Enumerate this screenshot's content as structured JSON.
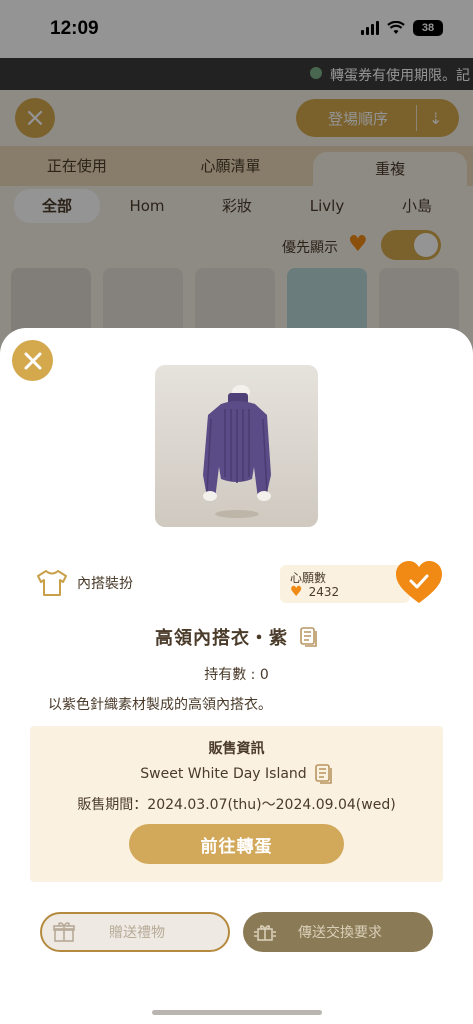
{
  "status_bar": {
    "time": "12:09",
    "battery": "38"
  },
  "ticker": {
    "text": "轉蛋券有使用期限。記"
  },
  "header": {
    "sort_label": "登場順序"
  },
  "main_tabs": [
    {
      "label": "正在使用"
    },
    {
      "label": "心願清單"
    },
    {
      "label": "重複"
    }
  ],
  "sub_tabs": [
    {
      "label": "全部"
    },
    {
      "label": "Hom"
    },
    {
      "label": "彩妝"
    },
    {
      "label": "Livly"
    },
    {
      "label": "小島"
    }
  ],
  "priority": {
    "label": "優先顯示"
  },
  "item": {
    "category": "內搭裝扮",
    "wish_title": "心願數",
    "wish_count": "2432",
    "name": "高領內搭衣・紫",
    "owned": "持有數 : 0",
    "description": "以紫色針織素材製成的高領內搭衣。"
  },
  "sale": {
    "title": "販售資訊",
    "island": "Sweet White Day Island",
    "period": "販售期間：2024.03.07(thu)～2024.09.04(wed)",
    "button": "前往轉蛋"
  },
  "actions": {
    "gift": "贈送禮物",
    "trade": "傳送交換要求"
  },
  "colors": {
    "accent_gold": "#d4a94e",
    "heart_orange": "#f08a14",
    "cream_panel": "#faf1e1",
    "sweater_purple": "#5b4b86"
  }
}
